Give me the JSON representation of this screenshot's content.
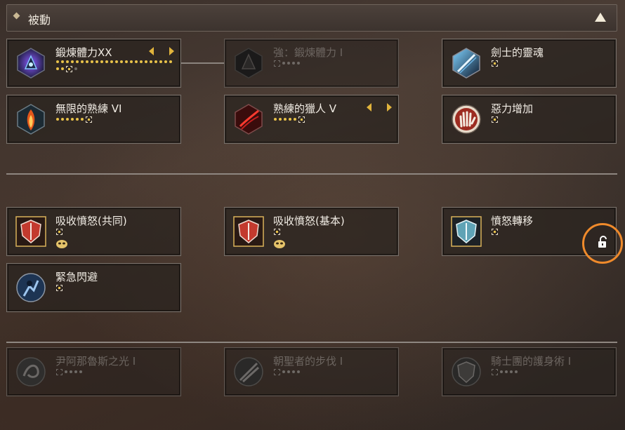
{
  "section": {
    "title": "被動"
  },
  "rows": [
    [
      {
        "name": "鍛煉體力XX",
        "level_dots": 24,
        "grey_dots": 1,
        "arrows": true,
        "dim": false,
        "icon": "armor-aura-icon"
      },
      {
        "name": "強：鍛煉體力 I",
        "level_dots": 0,
        "grey_dots": 4,
        "arrows": false,
        "dim": true,
        "icon": "dark-armor-icon"
      },
      {
        "name": "劍士的靈魂",
        "level_dots": 0,
        "grey_dots": 0,
        "arrows": false,
        "dim": false,
        "icon": "sword-soul-icon"
      }
    ],
    [
      {
        "name": "無限的熟練 VI",
        "level_dots": 5,
        "grey_dots": 0,
        "arrows": false,
        "dim": false,
        "icon": "flame-crystal-icon"
      },
      {
        "name": "熟練的獵人 V",
        "level_dots": 4,
        "grey_dots": 0,
        "arrows": true,
        "dim": false,
        "icon": "hunter-slash-icon"
      },
      {
        "name": "惡力增加",
        "level_dots": 0,
        "grey_dots": 0,
        "arrows": false,
        "dim": false,
        "icon": "open-hand-icon"
      }
    ],
    [
      {
        "name": "吸收憤怒(共同)",
        "level_dots": 0,
        "grey_dots": 0,
        "arrows": false,
        "dim": false,
        "icon": "rage-shield-icon",
        "mask": true
      },
      {
        "name": "吸收憤怒(基本)",
        "level_dots": 0,
        "grey_dots": 0,
        "arrows": false,
        "dim": false,
        "icon": "rage-shield-icon",
        "mask": true
      },
      {
        "name": "憤怒轉移",
        "level_dots": 0,
        "grey_dots": 0,
        "arrows": false,
        "dim": false,
        "icon": "blue-shield-icon",
        "lock": true
      }
    ],
    [
      {
        "name": "緊急閃避",
        "level_dots": 0,
        "grey_dots": 0,
        "arrows": false,
        "dim": false,
        "icon": "evade-icon"
      }
    ],
    [
      {
        "name": "尹阿那魯斯之光 I",
        "level_dots": 0,
        "grey_dots": 4,
        "arrows": false,
        "dim": true,
        "icon": "light-swirl-icon"
      },
      {
        "name": "朝聖者的步伐 I",
        "level_dots": 0,
        "grey_dots": 4,
        "arrows": false,
        "dim": true,
        "icon": "pilgrim-step-icon"
      },
      {
        "name": "騎士團的護身術 I",
        "level_dots": 0,
        "grey_dots": 4,
        "arrows": false,
        "dim": true,
        "icon": "knight-shield-icon"
      }
    ]
  ],
  "colors": {
    "accent_orange": "#ef8a2b",
    "gold_dot": "#e8c24a"
  }
}
